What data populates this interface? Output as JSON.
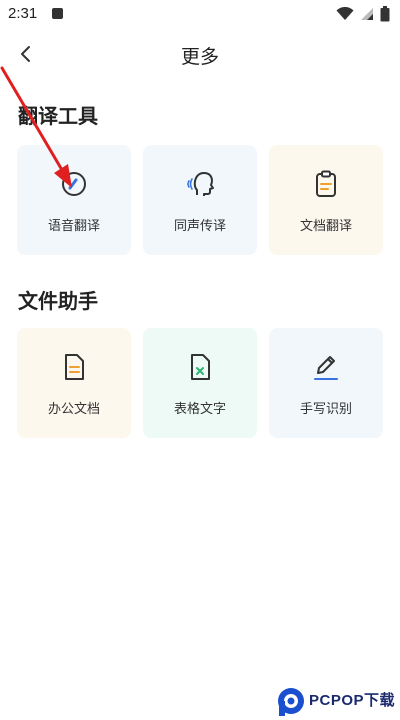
{
  "status_bar": {
    "time": "2:31"
  },
  "header": {
    "title": "更多"
  },
  "sections": [
    {
      "title": "翻译工具",
      "items": [
        {
          "label": "语音翻译",
          "icon": "voice-translate-icon",
          "bg": "#f2f7fc"
        },
        {
          "label": "同声传译",
          "icon": "simultaneous-interpret-icon",
          "bg": "#f2f7fc"
        },
        {
          "label": "文档翻译",
          "icon": "clipboard-icon",
          "bg": "#fdf8ee"
        }
      ]
    },
    {
      "title": "文件助手",
      "items": [
        {
          "label": "办公文档",
          "icon": "document-icon",
          "bg": "#fdf8ee"
        },
        {
          "label": "表格文字",
          "icon": "spreadsheet-icon",
          "bg": "#eefaf6"
        },
        {
          "label": "手写识别",
          "icon": "pen-icon",
          "bg": "#f2f7fc"
        }
      ]
    }
  ],
  "watermark": {
    "text": "PCPOP下载"
  },
  "colors": {
    "icon_stroke": "#333333",
    "accent_blue": "#3b73e0",
    "accent_orange": "#f0a030",
    "accent_green": "#2bb673",
    "annotation_red": "#e02020"
  }
}
